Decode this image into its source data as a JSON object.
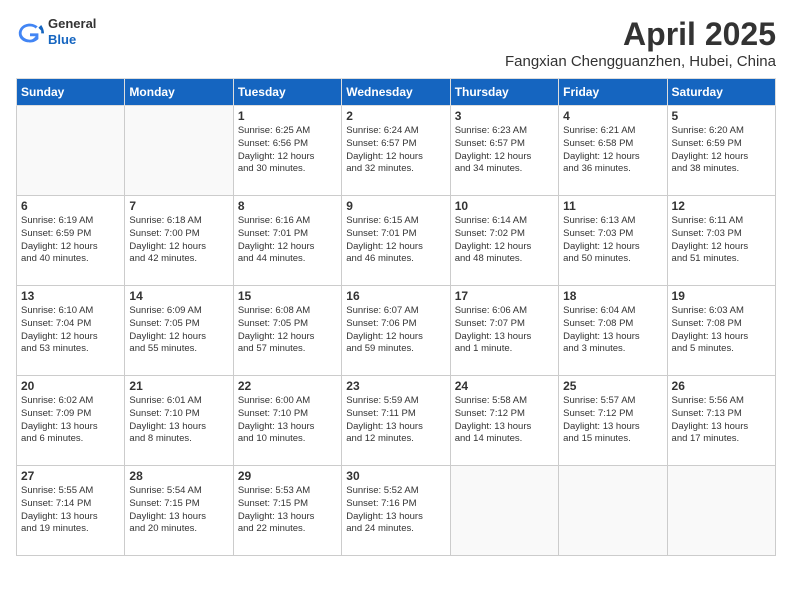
{
  "header": {
    "logo_general": "General",
    "logo_blue": "Blue",
    "month_title": "April 2025",
    "location": "Fangxian Chengguanzhen, Hubei, China"
  },
  "weekdays": [
    "Sunday",
    "Monday",
    "Tuesday",
    "Wednesday",
    "Thursday",
    "Friday",
    "Saturday"
  ],
  "weeks": [
    [
      {
        "day": "",
        "info": ""
      },
      {
        "day": "",
        "info": ""
      },
      {
        "day": "1",
        "info": "Sunrise: 6:25 AM\nSunset: 6:56 PM\nDaylight: 12 hours\nand 30 minutes."
      },
      {
        "day": "2",
        "info": "Sunrise: 6:24 AM\nSunset: 6:57 PM\nDaylight: 12 hours\nand 32 minutes."
      },
      {
        "day": "3",
        "info": "Sunrise: 6:23 AM\nSunset: 6:57 PM\nDaylight: 12 hours\nand 34 minutes."
      },
      {
        "day": "4",
        "info": "Sunrise: 6:21 AM\nSunset: 6:58 PM\nDaylight: 12 hours\nand 36 minutes."
      },
      {
        "day": "5",
        "info": "Sunrise: 6:20 AM\nSunset: 6:59 PM\nDaylight: 12 hours\nand 38 minutes."
      }
    ],
    [
      {
        "day": "6",
        "info": "Sunrise: 6:19 AM\nSunset: 6:59 PM\nDaylight: 12 hours\nand 40 minutes."
      },
      {
        "day": "7",
        "info": "Sunrise: 6:18 AM\nSunset: 7:00 PM\nDaylight: 12 hours\nand 42 minutes."
      },
      {
        "day": "8",
        "info": "Sunrise: 6:16 AM\nSunset: 7:01 PM\nDaylight: 12 hours\nand 44 minutes."
      },
      {
        "day": "9",
        "info": "Sunrise: 6:15 AM\nSunset: 7:01 PM\nDaylight: 12 hours\nand 46 minutes."
      },
      {
        "day": "10",
        "info": "Sunrise: 6:14 AM\nSunset: 7:02 PM\nDaylight: 12 hours\nand 48 minutes."
      },
      {
        "day": "11",
        "info": "Sunrise: 6:13 AM\nSunset: 7:03 PM\nDaylight: 12 hours\nand 50 minutes."
      },
      {
        "day": "12",
        "info": "Sunrise: 6:11 AM\nSunset: 7:03 PM\nDaylight: 12 hours\nand 51 minutes."
      }
    ],
    [
      {
        "day": "13",
        "info": "Sunrise: 6:10 AM\nSunset: 7:04 PM\nDaylight: 12 hours\nand 53 minutes."
      },
      {
        "day": "14",
        "info": "Sunrise: 6:09 AM\nSunset: 7:05 PM\nDaylight: 12 hours\nand 55 minutes."
      },
      {
        "day": "15",
        "info": "Sunrise: 6:08 AM\nSunset: 7:05 PM\nDaylight: 12 hours\nand 57 minutes."
      },
      {
        "day": "16",
        "info": "Sunrise: 6:07 AM\nSunset: 7:06 PM\nDaylight: 12 hours\nand 59 minutes."
      },
      {
        "day": "17",
        "info": "Sunrise: 6:06 AM\nSunset: 7:07 PM\nDaylight: 13 hours\nand 1 minute."
      },
      {
        "day": "18",
        "info": "Sunrise: 6:04 AM\nSunset: 7:08 PM\nDaylight: 13 hours\nand 3 minutes."
      },
      {
        "day": "19",
        "info": "Sunrise: 6:03 AM\nSunset: 7:08 PM\nDaylight: 13 hours\nand 5 minutes."
      }
    ],
    [
      {
        "day": "20",
        "info": "Sunrise: 6:02 AM\nSunset: 7:09 PM\nDaylight: 13 hours\nand 6 minutes."
      },
      {
        "day": "21",
        "info": "Sunrise: 6:01 AM\nSunset: 7:10 PM\nDaylight: 13 hours\nand 8 minutes."
      },
      {
        "day": "22",
        "info": "Sunrise: 6:00 AM\nSunset: 7:10 PM\nDaylight: 13 hours\nand 10 minutes."
      },
      {
        "day": "23",
        "info": "Sunrise: 5:59 AM\nSunset: 7:11 PM\nDaylight: 13 hours\nand 12 minutes."
      },
      {
        "day": "24",
        "info": "Sunrise: 5:58 AM\nSunset: 7:12 PM\nDaylight: 13 hours\nand 14 minutes."
      },
      {
        "day": "25",
        "info": "Sunrise: 5:57 AM\nSunset: 7:12 PM\nDaylight: 13 hours\nand 15 minutes."
      },
      {
        "day": "26",
        "info": "Sunrise: 5:56 AM\nSunset: 7:13 PM\nDaylight: 13 hours\nand 17 minutes."
      }
    ],
    [
      {
        "day": "27",
        "info": "Sunrise: 5:55 AM\nSunset: 7:14 PM\nDaylight: 13 hours\nand 19 minutes."
      },
      {
        "day": "28",
        "info": "Sunrise: 5:54 AM\nSunset: 7:15 PM\nDaylight: 13 hours\nand 20 minutes."
      },
      {
        "day": "29",
        "info": "Sunrise: 5:53 AM\nSunset: 7:15 PM\nDaylight: 13 hours\nand 22 minutes."
      },
      {
        "day": "30",
        "info": "Sunrise: 5:52 AM\nSunset: 7:16 PM\nDaylight: 13 hours\nand 24 minutes."
      },
      {
        "day": "",
        "info": ""
      },
      {
        "day": "",
        "info": ""
      },
      {
        "day": "",
        "info": ""
      }
    ]
  ]
}
